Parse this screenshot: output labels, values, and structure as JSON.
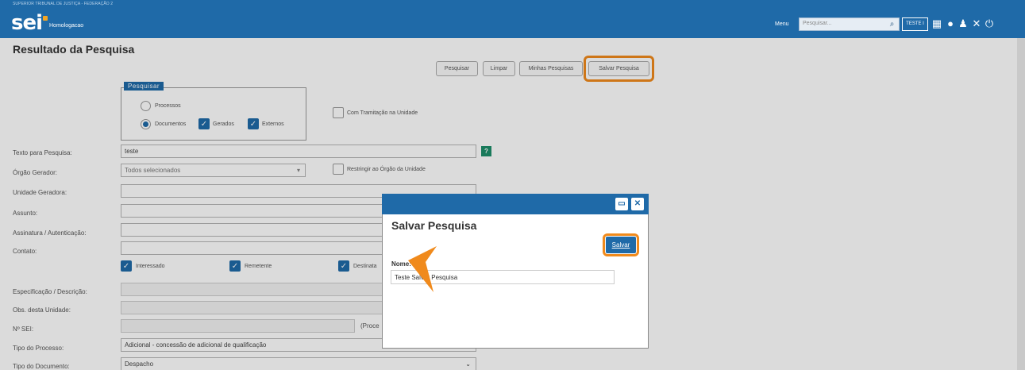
{
  "header": {
    "top_text": "SUPERIOR TRIBUNAL DE JUSTIÇA - FEDERAÇÃO 2",
    "logo": "sei",
    "environment": "Homologacao",
    "menu_label": "Menu",
    "search_placeholder": "Pesquisar...",
    "unit_button": "TESTE I",
    "icons": [
      "search-icon",
      "grid-icon",
      "info-icon",
      "user-icon",
      "tools-icon",
      "power-icon"
    ]
  },
  "page": {
    "title": "Resultado da Pesquisa",
    "buttons": {
      "pesquisar": "Pesquisar",
      "limpar": "Limpar",
      "minhas": "Minhas Pesquisas",
      "salvar": "Salvar Pesquisa"
    },
    "fieldset": {
      "legend": "Pesquisar",
      "processos": "Processos",
      "documentos": "Documentos",
      "gerados": "Gerados",
      "externos": "Externos"
    },
    "com_tramitacao": "Com Tramitação na Unidade",
    "labels": {
      "texto": "Texto para Pesquisa:",
      "orgao": "Órgão Gerador:",
      "unidade": "Unidade Geradora:",
      "assunto": "Assunto:",
      "assinatura": "Assinatura / Autenticação:",
      "contato": "Contato:",
      "especificacao": "Especificação / Descrição:",
      "obs": "Obs. desta Unidade:",
      "nsei": "Nº SEI:",
      "tipo_processo": "Tipo do Processo:",
      "tipo_documento": "Tipo do Documento:"
    },
    "values": {
      "texto": "teste",
      "orgao": "Todos selecionados",
      "tipo_processo": "Adicional - concessão de adicional de qualificação",
      "tipo_documento": "Despacho",
      "nsei_hint": "(Proce"
    },
    "restringir": "Restringir ao Órgão da Unidade",
    "contato_checks": {
      "interessado": "Interessado",
      "remetente": "Remetente",
      "destinatario": "Destinata"
    },
    "help": "?"
  },
  "modal": {
    "title": "Salvar Pesquisa",
    "save_button": "Salvar",
    "name_label": "Nome:",
    "name_value": "Teste Salvar Pesquisa"
  },
  "colors": {
    "primary": "#1f6aa8",
    "highlight": "#f08a1c"
  }
}
